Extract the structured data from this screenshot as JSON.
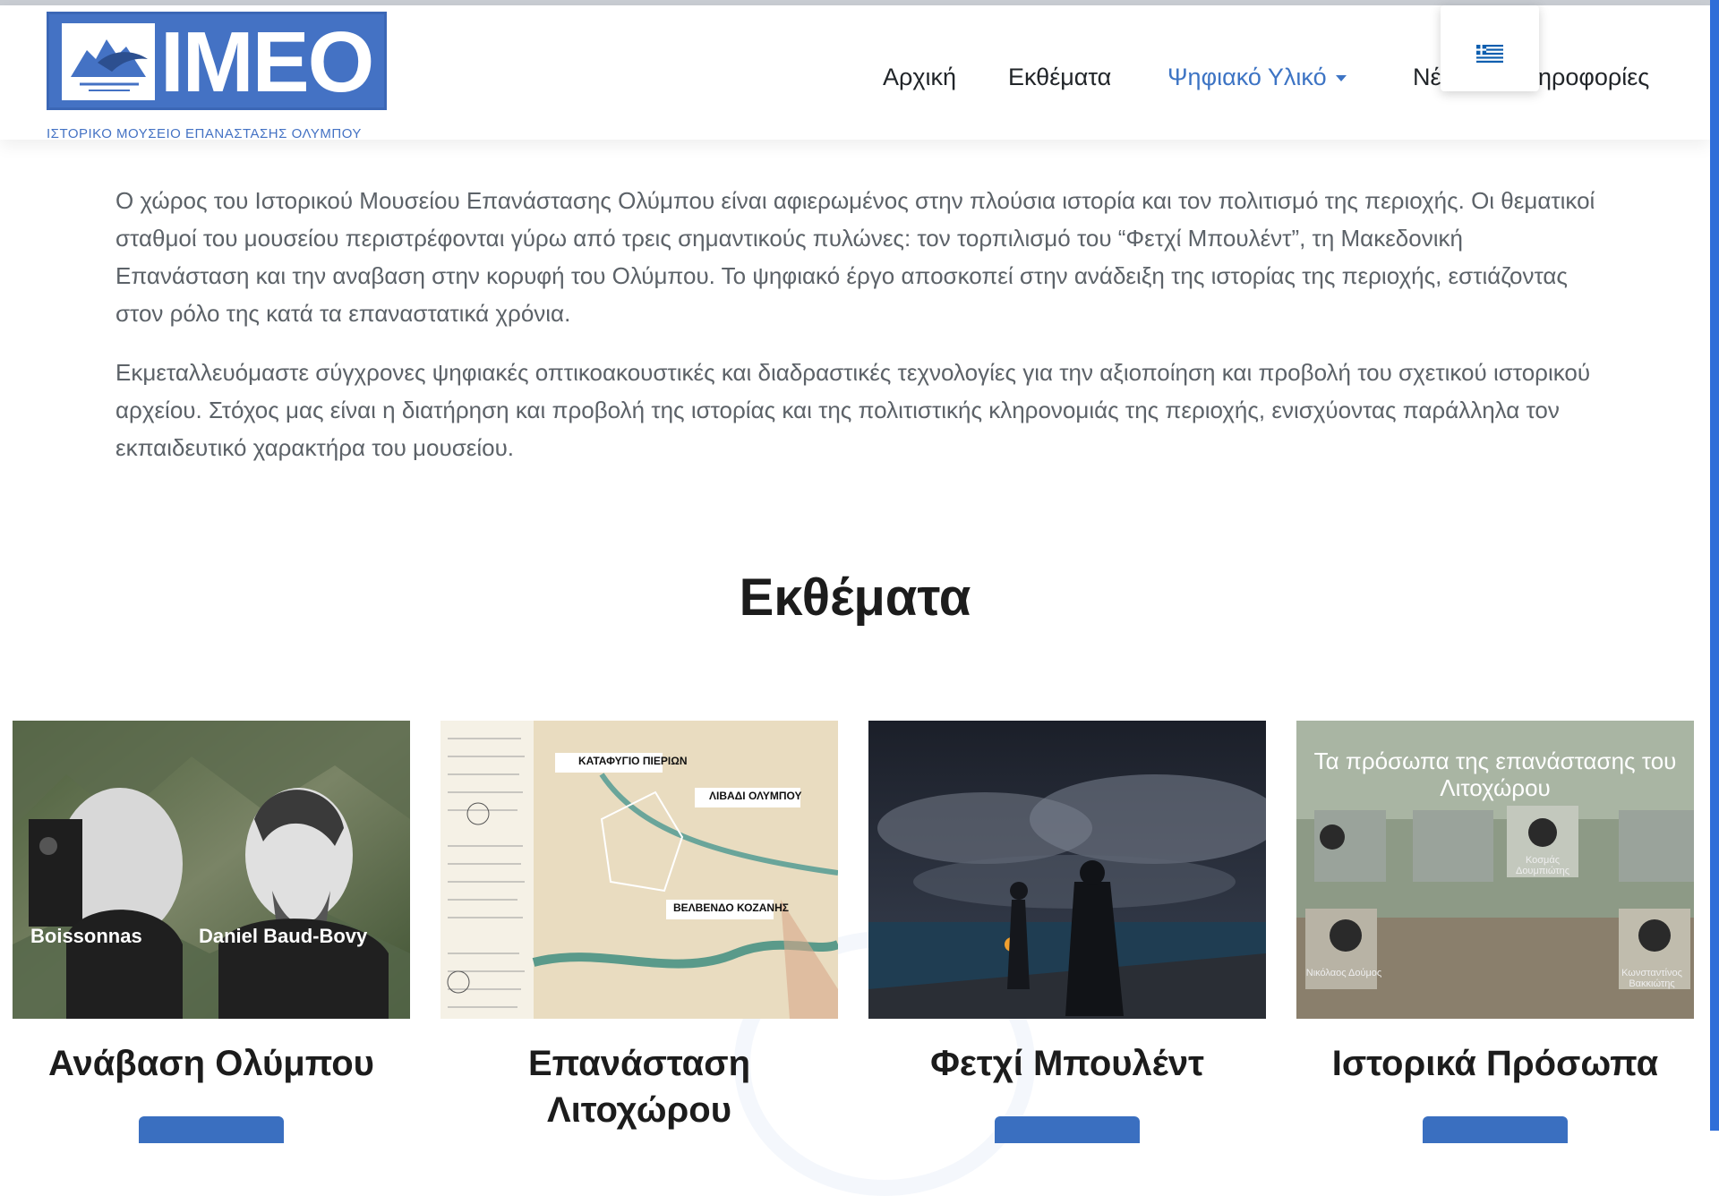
{
  "logo": {
    "text": "IMEO",
    "subtitle": "ΙΣΤΟΡΙΚΟ ΜΟΥΣΕΙΟ ΕΠΑΝΑΣΤΑΣΗΣ ΟΛΥΜΠΟΥ"
  },
  "nav": {
    "items": [
      {
        "label": "Αρχική"
      },
      {
        "label": "Εκθέματα"
      },
      {
        "label": "Ψηφιακό Υλικό"
      },
      {
        "label": "Νέ"
      },
      {
        "label": "ηροφορίες"
      }
    ]
  },
  "language": {
    "selected": "el-flag"
  },
  "intro": {
    "p1": "Ο χώρος του Ιστορικού Μουσείου Επανάστασης Ολύμπου είναι αφιερωμένος στην πλούσια ιστορία και τον πολιτισμό της περιοχής. Οι θεματικοί σταθμοί του μουσείου περιστρέφονται γύρω από τρεις σημαντικούς πυλώνες: τον τορπιλισμό του “Φετχί Μπουλέντ”, τη Μακεδονική Επανάσταση και την αναβαση στην κορυφή του Ολύμπου. Το ψηφιακό έργο αποσκοπεί στην ανάδειξη της ιστορίας της περιοχής, εστιάζοντας στον ρόλο της κατά τα επαναστατικά χρόνια.",
    "p2": "Εκμεταλλευόμαστε σύγχρονες ψηφιακές οπτικοακουστικές και διαδραστικές τεχνολογίες για την αξιοποίηση και προβολή του σχετικού ιστορικού αρχείου. Στόχος μας είναι η διατήρηση και προβολή της ιστορίας και της πολιτιστικής κληρονομιάς της περιοχής, ενισχύοντας παράλληλα τον εκπαιδευτικό χαρακτήρα του μουσείου."
  },
  "exhibits": {
    "title": "Εκθέματα",
    "cards": [
      {
        "title": "Ανάβαση Ολύμπου",
        "labels": [
          "Boissonnas",
          "Daniel Baud-Bovy"
        ]
      },
      {
        "title": "Επανάσταση Λιτοχώρου",
        "labels": [
          "ΚΑΤΑΦΥΓΙΟ ΠΙΕΡΙΩΝ",
          "ΛΙΒΑΔΙ ΟΛΥΜΠΟΥ",
          "ΒΕΛΒΕΝΔΟ ΚΟΖΑΝΗΣ"
        ]
      },
      {
        "title": "Φετχί Μπουλέντ",
        "labels": []
      },
      {
        "title": "Ιστορικά Πρόσωπα",
        "labels": [
          "Τα πρόσωπα της επανάστασης του Λιτοχώρου",
          "Κοσμάς Δουμπιώτης",
          "Νικόλαος Δούμος",
          "Κωνσταντίνος Βακκιώτης"
        ]
      }
    ]
  },
  "colors": {
    "brand": "#4472c4",
    "nav_active": "#3d74c4",
    "button": "#3a6fc0"
  }
}
